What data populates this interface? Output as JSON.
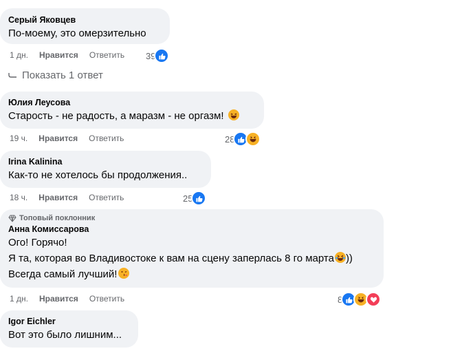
{
  "comments": [
    {
      "author": "Серый Яковцев",
      "lines": [
        "По-моему, это омерзительно"
      ],
      "time": "1 дн.",
      "like": "Нравится",
      "reply": "Ответить",
      "count": "39"
    },
    {
      "author": "Юлия Леусова",
      "lines": [
        "Старость - не радость, а маразм - не оргазм!"
      ],
      "time": "19 ч.",
      "like": "Нравится",
      "reply": "Ответить",
      "count": "28"
    },
    {
      "author": "Irina Kalinina",
      "lines": [
        "Как-то не хотелось бы продолжения.."
      ],
      "time": "18 ч.",
      "like": "Нравится",
      "reply": "Ответить",
      "count": "25"
    },
    {
      "badge": "Топовый поклонник",
      "author": "Анна Комиссарова",
      "lines": [
        "Ого! Горячо!",
        "Я та, которая во Владивостоке к вам на сцену заперлась 8 го марта",
        "))",
        "Всегда самый лучший!"
      ],
      "time": "1 дн.",
      "like": "Нравится",
      "reply": "Ответить",
      "count": "8"
    },
    {
      "author": "Igor Eichler",
      "lines": [
        "Вот это было лишним..."
      ]
    }
  ],
  "show_replies": "Показать 1 ответ",
  "icons": {
    "like": "thumbs-up-icon",
    "haha": "laughing-emoji-icon",
    "love": "heart-icon",
    "badge": "diamond-icon",
    "reply_arrow": "reply-arrow-icon"
  },
  "colors": {
    "bubble": "#f0f2f5",
    "like_blue": "#1877f2",
    "muted_text": "#65676b"
  }
}
